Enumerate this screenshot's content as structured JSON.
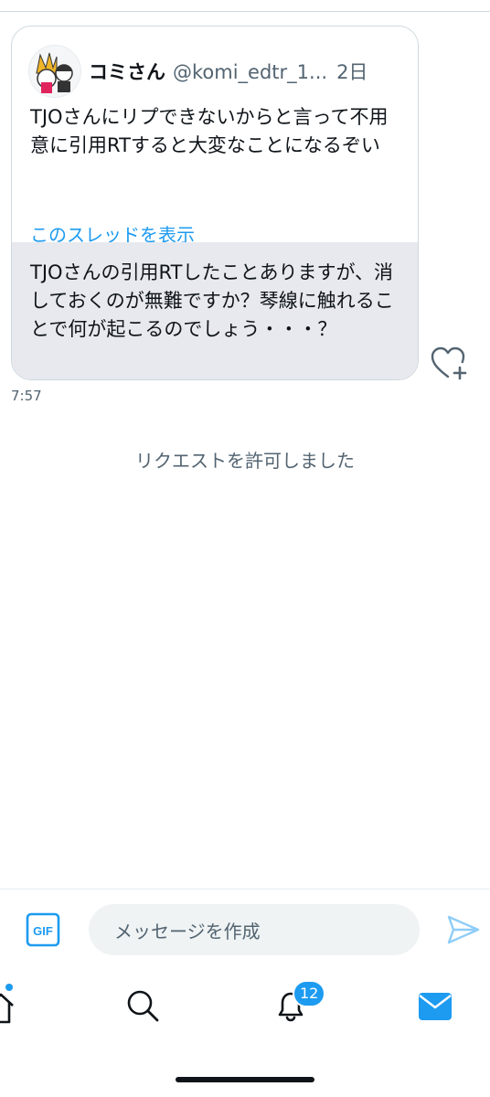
{
  "quoted_tweet": {
    "display_name": "コミさん",
    "handle": "@komi_edtr_1...",
    "time": "2日",
    "text": "TJOさんにリプできないからと言って不用意に引用RTすると大変なことになるぞい",
    "thread_link": "このスレッドを表示"
  },
  "message": {
    "text": "TJOさんの引用RTしたことありますが、消しておくのが無難ですか？琴線に触れることで何が起こるのでしょう・・・？",
    "time": "7:57"
  },
  "system_message": "リクエストを許可しました",
  "composer": {
    "gif_label": "GIF",
    "placeholder": "メッセージを作成"
  },
  "tab_bar": {
    "notifications_badge": "12"
  },
  "colors": {
    "accent": "#1d9bf0",
    "bubble_gray": "#e7e9ee",
    "secondary_text": "#536471"
  }
}
